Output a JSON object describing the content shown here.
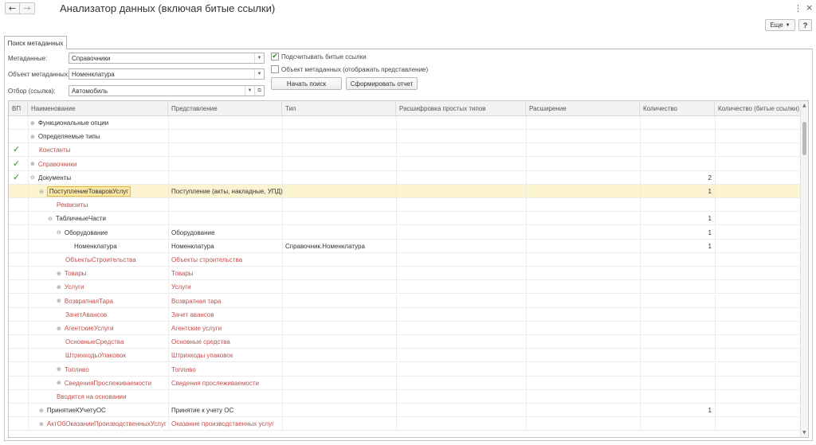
{
  "window": {
    "title": "Анализатор данных (включая битые ссылки)",
    "more_label": "Еще",
    "help_label": "?"
  },
  "tab": {
    "label": "Поиск метаданных"
  },
  "form": {
    "metadata_label": "Метаданные:",
    "metadata_value": "Справочники",
    "object_label": "Объект метаданных:",
    "object_value": "Номенклатура",
    "filter_label": "Отбор (ссылка):",
    "filter_value": "Автомобиль",
    "count_broken_label": "Подсчитывать битые ссылки",
    "count_broken_checked": true,
    "show_repr_label": "Объект метаданных (отображать представление)",
    "show_repr_checked": false,
    "search_button": "Начать поиск",
    "report_button": "Сформировать отчет"
  },
  "grid": {
    "columns": [
      "ВП",
      "Наименование",
      "Представление",
      "Тип",
      "Расшифровка простых типов",
      "Расширение",
      "Количество",
      "Количество (битые ссылки)"
    ],
    "rows": [
      {
        "vp": "",
        "expander": "⊕",
        "name": "Функциональные опции",
        "repr": "",
        "type": "",
        "count": "",
        "red": false,
        "level": 0
      },
      {
        "vp": "",
        "expander": "⊕",
        "name": "Определяемые типы",
        "repr": "",
        "type": "",
        "count": "",
        "red": false,
        "level": 0
      },
      {
        "vp": "✓",
        "expander": "",
        "name": "Константы",
        "repr": "",
        "type": "",
        "count": "",
        "red": true,
        "level": 0
      },
      {
        "vp": "✓",
        "expander": "⊕",
        "name": "Справочники",
        "repr": "",
        "type": "",
        "count": "",
        "red": true,
        "level": 0
      },
      {
        "vp": "✓",
        "expander": "⊖",
        "name": "Документы",
        "repr": "",
        "type": "",
        "count": "2",
        "red": false,
        "level": 0
      },
      {
        "vp": "",
        "expander": "⊖",
        "name": "ПоступлениеТоваровУслуг",
        "repr": "Поступление (акты, накладные, УПД)",
        "type": "",
        "count": "1",
        "red": false,
        "level": 1,
        "selected": true
      },
      {
        "vp": "",
        "expander": "",
        "name": "Реквизиты",
        "repr": "",
        "type": "",
        "count": "",
        "red": true,
        "level": 2
      },
      {
        "vp": "",
        "expander": "⊖",
        "name": "ТабличныеЧасти",
        "repr": "",
        "type": "",
        "count": "1",
        "red": false,
        "level": 2
      },
      {
        "vp": "",
        "expander": "⊖",
        "name": "Оборудование",
        "repr": "Оборудование",
        "type": "",
        "count": "1",
        "red": false,
        "level": 3
      },
      {
        "vp": "",
        "expander": "",
        "name": "Номенклатура",
        "repr": "Номенклатура",
        "type": "Справочник.Номенклатура",
        "count": "1",
        "red": false,
        "level": 4
      },
      {
        "vp": "",
        "expander": "",
        "name": "ОбъектыСтроительства",
        "repr": "Объекты строительства",
        "type": "",
        "count": "",
        "red": true,
        "level": 3
      },
      {
        "vp": "",
        "expander": "⊕",
        "name": "Товары",
        "repr": "Товары",
        "type": "",
        "count": "",
        "red": true,
        "level": 3
      },
      {
        "vp": "",
        "expander": "⊕",
        "name": "Услуги",
        "repr": "Услуги",
        "type": "",
        "count": "",
        "red": true,
        "level": 3
      },
      {
        "vp": "",
        "expander": "⊕",
        "name": "ВозвратнаяТара",
        "repr": "Возвратная тара",
        "type": "",
        "count": "",
        "red": true,
        "level": 3
      },
      {
        "vp": "",
        "expander": "",
        "name": "ЗачетАвансов",
        "repr": "Зачет авансов",
        "type": "",
        "count": "",
        "red": true,
        "level": 3
      },
      {
        "vp": "",
        "expander": "⊕",
        "name": "АгентскиеУслуги",
        "repr": "Агентские услуги",
        "type": "",
        "count": "",
        "red": true,
        "level": 3
      },
      {
        "vp": "",
        "expander": "",
        "name": "ОсновныеСредства",
        "repr": "Основные средства",
        "type": "",
        "count": "",
        "red": true,
        "level": 3
      },
      {
        "vp": "",
        "expander": "",
        "name": "ШтрихкодыУпаковок",
        "repr": "Штрихкоды упаковок",
        "type": "",
        "count": "",
        "red": true,
        "level": 3
      },
      {
        "vp": "",
        "expander": "⊕",
        "name": "Топливо",
        "repr": "Топливо",
        "type": "",
        "count": "",
        "red": true,
        "level": 3
      },
      {
        "vp": "",
        "expander": "⊕",
        "name": "СведенияПрослеживаемости",
        "repr": "Сведения прослеживаемости",
        "type": "",
        "count": "",
        "red": true,
        "level": 3
      },
      {
        "vp": "",
        "expander": "",
        "name": "Вводится на основании",
        "repr": "",
        "type": "",
        "count": "",
        "red": true,
        "level": 2
      },
      {
        "vp": "",
        "expander": "⊕",
        "name": "ПринятиеКУчетуОС",
        "repr": "Принятие к учету ОС",
        "type": "",
        "count": "1",
        "red": false,
        "level": 1
      },
      {
        "vp": "",
        "expander": "⊕",
        "name": "АктОбОказанииПроизводственныхУслуг",
        "repr": "Оказание производственных услуг",
        "type": "",
        "count": "",
        "red": true,
        "level": 1
      }
    ]
  },
  "colors": {
    "red_text": "#c0504d",
    "check_green": "#2e8b2e",
    "selected_row": "#fcf3d0"
  }
}
